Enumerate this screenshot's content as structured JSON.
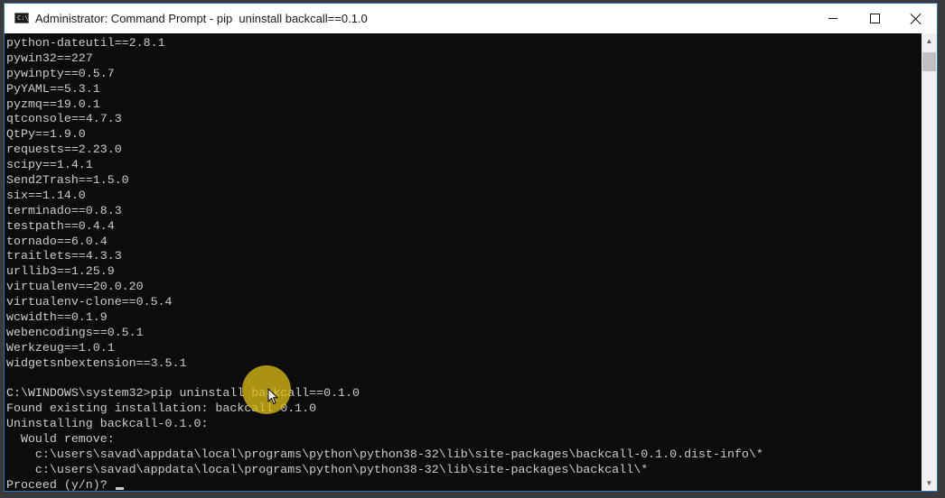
{
  "window": {
    "title": "Administrator: Command Prompt - pip  uninstall backcall==0.1.0",
    "app_icon_text": "C:\\",
    "buttons": {
      "minimize": "minimize",
      "maximize": "maximize",
      "close": "close"
    }
  },
  "console": {
    "lines": [
      "python-dateutil==2.8.1",
      "pywin32==227",
      "pywinpty==0.5.7",
      "PyYAML==5.3.1",
      "pyzmq==19.0.1",
      "qtconsole==4.7.3",
      "QtPy==1.9.0",
      "requests==2.23.0",
      "scipy==1.4.1",
      "Send2Trash==1.5.0",
      "six==1.14.0",
      "terminado==0.8.3",
      "testpath==0.4.4",
      "tornado==6.0.4",
      "traitlets==4.3.3",
      "urllib3==1.25.9",
      "virtualenv==20.0.20",
      "virtualenv-clone==0.5.4",
      "wcwidth==0.1.9",
      "webencodings==0.5.1",
      "Werkzeug==1.0.1",
      "widgetsnbextension==3.5.1",
      "",
      "C:\\WINDOWS\\system32>pip uninstall backcall==0.1.0",
      "Found existing installation: backcall 0.1.0",
      "Uninstalling backcall-0.1.0:",
      "  Would remove:",
      "    c:\\users\\savad\\appdata\\local\\programs\\python\\python38-32\\lib\\site-packages\\backcall-0.1.0.dist-info\\*",
      "    c:\\users\\savad\\appdata\\local\\programs\\python\\python38-32\\lib\\site-packages\\backcall\\*"
    ],
    "prompt": "Proceed (y/n)? "
  },
  "colors": {
    "console_bg": "#0c0c0c",
    "console_fg": "#cccccc",
    "titlebar_bg": "#ffffff",
    "border": "#2a72b8",
    "highlight": "#d7b914"
  },
  "icons": {
    "scroll_up": "▲",
    "scroll_down": "▼"
  }
}
